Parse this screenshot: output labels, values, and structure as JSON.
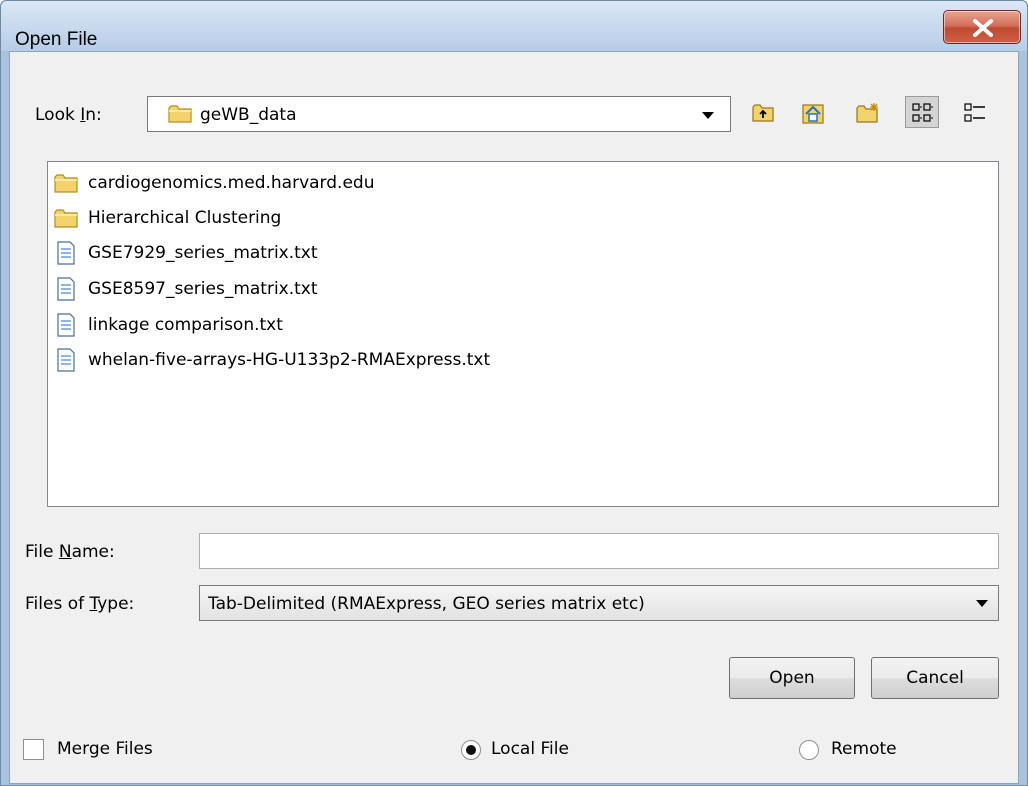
{
  "window": {
    "title": "Open File"
  },
  "look_in": {
    "label_pre": "Look ",
    "label_key": "I",
    "label_post": "n:",
    "value": "geWB_data"
  },
  "toolbar": {
    "up": "up-folder-icon",
    "home": "home-icon",
    "new_folder": "new-folder-icon",
    "list_view": "list-view-icon",
    "details_view": "details-view-icon"
  },
  "files": [
    {
      "name": "cardiogenomics.med.harvard.edu",
      "kind": "folder"
    },
    {
      "name": "Hierarchical Clustering",
      "kind": "folder"
    },
    {
      "name": "GSE7929_series_matrix.txt",
      "kind": "file"
    },
    {
      "name": "GSE8597_series_matrix.txt",
      "kind": "file"
    },
    {
      "name": "linkage comparison.txt",
      "kind": "file"
    },
    {
      "name": "whelan-five-arrays-HG-U133p2-RMAExpress.txt",
      "kind": "file"
    }
  ],
  "file_name": {
    "label_pre": "File ",
    "label_key": "N",
    "label_post": "ame:",
    "value": ""
  },
  "file_type": {
    "label_pre": "Files of ",
    "label_key": "T",
    "label_post": "ype:",
    "value": "Tab-Delimited (RMAExpress, GEO series matrix etc)"
  },
  "buttons": {
    "open": "Open",
    "cancel": "Cancel"
  },
  "options": {
    "merge_files": {
      "label": "Merge Files",
      "checked": false
    },
    "local_file": {
      "label": "Local File",
      "selected": true
    },
    "remote": {
      "label": "Remote",
      "selected": false
    }
  }
}
